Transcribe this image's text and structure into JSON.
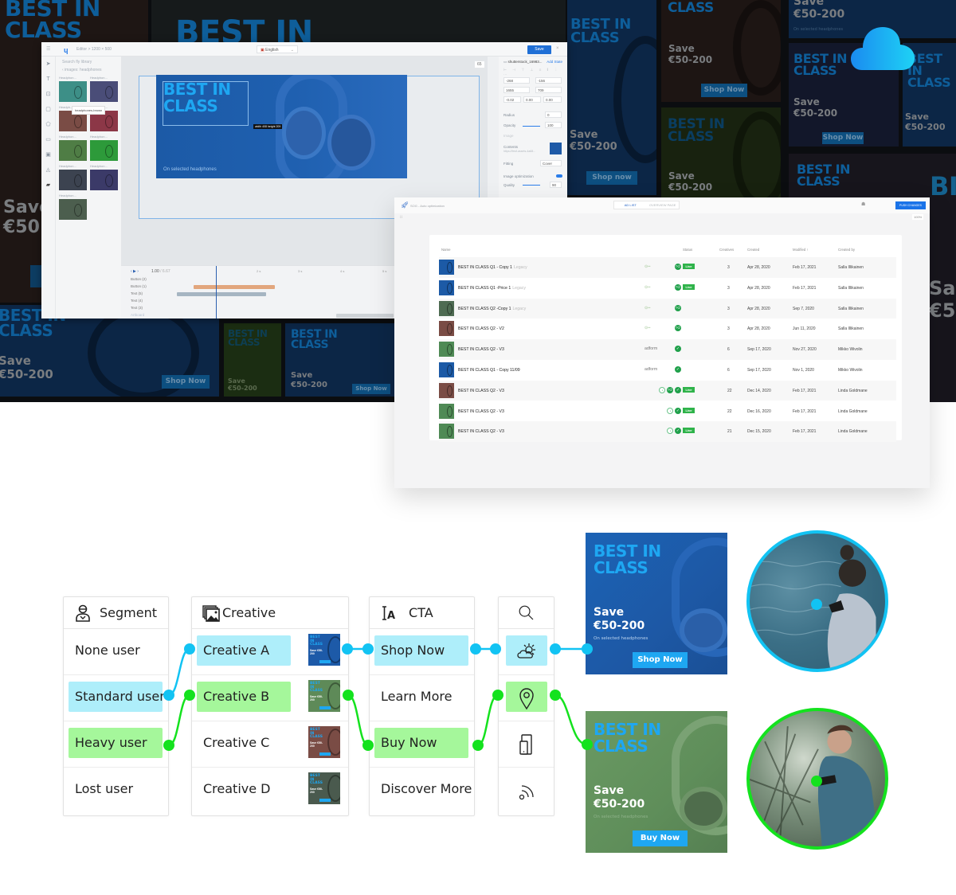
{
  "background_banners": {
    "headline": "BEST IN CLASS",
    "headline_line1": "BEST IN",
    "headline_line2": "CLASS",
    "save_line1": "Save",
    "save_line2": "€50-200",
    "subline": "On selected headphones",
    "cta_shop_now": "Shop Now",
    "cta_shop_now_lower": "Shop now",
    "partial_save": "Save",
    "partial_price": "€50",
    "partial_b": "BI",
    "partial_sa": "Sa",
    "partial_c5": "€5"
  },
  "cloud_icon": "cloud-icon",
  "editor": {
    "breadcrumb": "Editor  >  1200 × 500",
    "language": "English",
    "save_label": "Save",
    "library_search": "Search fly library",
    "library_path": "‹  images: headphones",
    "library_items": [
      {
        "label": "Headphon...",
        "color": "#3d8f87"
      },
      {
        "label": "Headphon...",
        "color": "#4a4d78"
      },
      {
        "label": "Headph...",
        "color": "#7a4c45"
      },
      {
        "label": "Headphon...",
        "color": "#8c3747"
      },
      {
        "label": "Headphon...",
        "color": "#4f7d45"
      },
      {
        "label": "Headphon...",
        "color": "#2d9a3a"
      },
      {
        "label": "Headphon...",
        "color": "#3c4350"
      },
      {
        "label": "Headphon...",
        "color": "#3b3a68"
      },
      {
        "label": "Headphon...",
        "color": "#4c5e4e"
      }
    ],
    "tooltip": "headphones-brown",
    "zoom_level": "65",
    "banner": {
      "title_line1": "BEST IN",
      "title_line2": "CLASS",
      "subline": "On selected headphones",
      "dimension_tip": "width 408 height 209"
    },
    "props": {
      "layer_name": "shutterstock_16983...",
      "add_state": "Add State",
      "x": "-268",
      "y": "-156",
      "w": "1655",
      "h": "709",
      "rotation": "-0.02",
      "skew_x": "0.00",
      "skew_y": "0.00",
      "radius_label": "Radius",
      "radius_value": "0",
      "opacity_label": "Opacity",
      "opacity_value": "100",
      "image_section": "Image",
      "content_label": "Contents",
      "content_file": "https://fewf-assets-4a68...",
      "fitting_label": "Fitting",
      "fitting_value": "Cover",
      "optimization_label": "Image optimization",
      "quality_label": "Quality",
      "quality_value": "90"
    },
    "timeline": {
      "time": "1.00",
      "duration": "/ 6.67",
      "ticks": [
        "2 s",
        "3 s",
        "4 s",
        "5 s"
      ],
      "rows": [
        "Button (2)",
        "Button (1)",
        "Text (5)",
        "Text (4)",
        "Text (3)",
        "Artboard"
      ]
    }
  },
  "adlist": {
    "title": "SOG - Auto optimization",
    "tabs": [
      {
        "label": "AD LIST",
        "active": true
      },
      {
        "label": "OVERVIEW PAGE",
        "active": false
      }
    ],
    "push_label": "PUSH CHANGES",
    "zoom": "100%",
    "columns": [
      "Name",
      "Status",
      "Creatives",
      "Created",
      "Modified ↑",
      "Created by"
    ],
    "rows": [
      {
        "thumb": "#1c5aa6",
        "name": "BEST IN CLASS Q1 - Copy 1",
        "tag": "Legacy",
        "platform": "logo",
        "icons": [
          "thumb"
        ],
        "live": true,
        "creatives": "3",
        "created": "Apr 28, 2020",
        "modified": "Feb 17, 2021",
        "by": "Salla Illikainen"
      },
      {
        "thumb": "#1c5aa6",
        "name": "BEST IN CLASS Q1 -Price 1",
        "tag": "Legacy",
        "platform": "logo",
        "icons": [
          "thumb"
        ],
        "live": true,
        "creatives": "3",
        "created": "Apr 28, 2020",
        "modified": "Feb 17, 2021",
        "by": "Salla Illikainen"
      },
      {
        "thumb": "#4e6b52",
        "name": "BEST IN CLASS Q2 -Copy 1",
        "tag": "Legacy",
        "platform": "logo",
        "icons": [
          "thumb"
        ],
        "live": false,
        "creatives": "3",
        "created": "Apr 28, 2020",
        "modified": "Sep 7, 2020",
        "by": "Salla Illikainen"
      },
      {
        "thumb": "#7a4c45",
        "name": "BEST IN CLASS Q2 - V2",
        "tag": "",
        "platform": "logo",
        "icons": [
          "thumb"
        ],
        "live": false,
        "creatives": "3",
        "created": "Apr 28, 2020",
        "modified": "Jun 11, 2020",
        "by": "Salla Illikainen"
      },
      {
        "thumb": "#4f8a55",
        "name": "BEST IN CLASS Q2 - V3",
        "tag": "",
        "platform": "adform",
        "icons": [
          "check"
        ],
        "live": false,
        "creatives": "6",
        "created": "Sep 17, 2020",
        "modified": "Nov 27, 2020",
        "by": "Mikko Wivolin"
      },
      {
        "thumb": "#1c5aa6",
        "name": "BEST IN CLASS Q1 - Copy 11/09",
        "tag": "",
        "platform": "adform",
        "icons": [
          "check"
        ],
        "live": false,
        "creatives": "6",
        "created": "Sep 17, 2020",
        "modified": "Nov 1, 2020",
        "by": "Mikko Wivolin"
      },
      {
        "thumb": "#7a4c45",
        "name": "BEST IN CLASS Q2 - V3",
        "tag": "",
        "platform": "",
        "icons": [
          "ring",
          "thumb",
          "check"
        ],
        "live": true,
        "creatives": "22",
        "created": "Dec 14, 2020",
        "modified": "Feb 17, 2021",
        "by": "Linda Goldmane"
      },
      {
        "thumb": "#4f8a55",
        "name": "BEST IN CLASS Q2 - V3",
        "tag": "",
        "platform": "",
        "icons": [
          "ring",
          "check"
        ],
        "live": true,
        "creatives": "22",
        "created": "Dec 16, 2020",
        "modified": "Feb 17, 2021",
        "by": "Linda Goldmane"
      },
      {
        "thumb": "#4f8a55",
        "name": "BEST IN CLASS Q2 - V3",
        "tag": "",
        "platform": "",
        "icons": [
          "ring",
          "check"
        ],
        "live": true,
        "creatives": "21",
        "created": "Dec 15, 2020",
        "modified": "Feb 17, 2021",
        "by": "Linda Goldmane"
      }
    ],
    "live_label": "Live",
    "adform_label": "adform"
  },
  "flow": {
    "segment": {
      "header": "Segment",
      "icon": "user-icon",
      "items": [
        {
          "label": "None user",
          "highlight": ""
        },
        {
          "label": "Standard user",
          "highlight": "blue"
        },
        {
          "label": "Heavy user",
          "highlight": "green"
        },
        {
          "label": "Lost user",
          "highlight": ""
        }
      ]
    },
    "creative": {
      "header": "Creative",
      "icon": "images-icon",
      "items": [
        {
          "label": "Creative A",
          "highlight": "blue",
          "thumb": "#1d5aa8"
        },
        {
          "label": "Creative B",
          "highlight": "green",
          "thumb": "#5e8a58"
        },
        {
          "label": "Creative C",
          "highlight": "",
          "thumb": "#7a4c45"
        },
        {
          "label": "Creative D",
          "highlight": "",
          "thumb": "#4a5a4e"
        }
      ],
      "mini_title": "BEST IN CLASS",
      "mini_save": "Save €50-200"
    },
    "cta": {
      "header": "CTA",
      "icon": "text-style-icon",
      "items": [
        {
          "label": "Shop Now",
          "highlight": "blue"
        },
        {
          "label": "Learn More",
          "highlight": ""
        },
        {
          "label": "Buy Now",
          "highlight": "green"
        },
        {
          "label": "Discover More",
          "highlight": ""
        }
      ]
    },
    "context": {
      "header_icon": "search-icon",
      "items": [
        {
          "icon": "weather-icon",
          "highlight": "blue"
        },
        {
          "icon": "location-pin-icon",
          "highlight": "green"
        },
        {
          "icon": "devices-icon",
          "highlight": ""
        },
        {
          "icon": "wifi-signal-icon",
          "highlight": ""
        }
      ]
    },
    "results": [
      {
        "title_line1": "BEST IN",
        "title_line2": "CLASS",
        "save_line1": "Save",
        "save_line2": "€50-200",
        "subline": "On selected headphones",
        "button": "Shop Now",
        "variant": "blue"
      },
      {
        "title_line1": "BEST IN",
        "title_line2": "CLASS",
        "save_line1": "Save",
        "save_line2": "€50-200",
        "subline": "On selected headphones",
        "button": "Buy Now",
        "variant": "green"
      }
    ],
    "colors": {
      "blue": "#12c3f3",
      "green": "#14e21e",
      "blue_fill": "#aeeefa",
      "green_fill": "#a5f79b"
    }
  }
}
